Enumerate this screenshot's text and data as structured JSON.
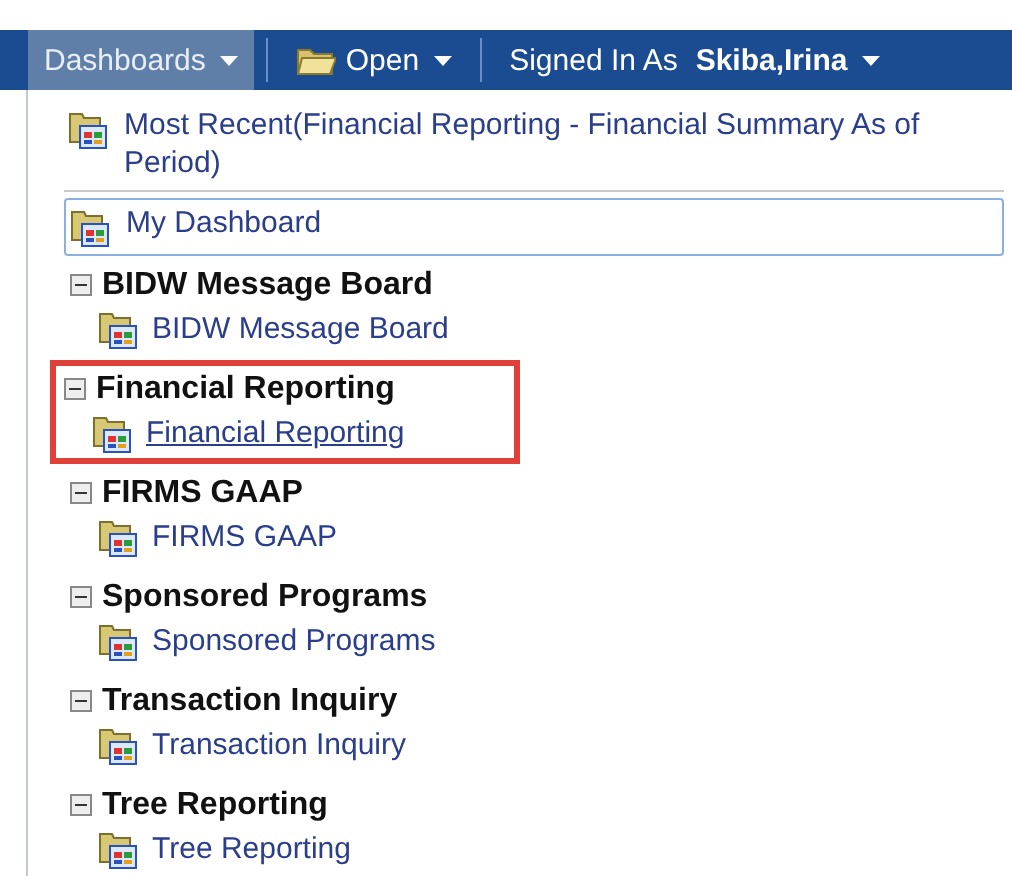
{
  "menu_bar": {
    "items": [
      {
        "label": "Dashboards",
        "kind": "dropdown",
        "selected": true
      },
      {
        "label": "Open",
        "kind": "folder",
        "selected": false
      },
      {
        "label": "Signed In As",
        "user": "Skiba,Irina",
        "kind": "user",
        "selected": false
      }
    ]
  },
  "menu": {
    "top_items": [
      {
        "label": "Most Recent(Financial Reporting - Financial Summary As of Period)",
        "focused": false
      },
      {
        "label": "My Dashboard",
        "focused": true
      }
    ],
    "groups": [
      {
        "title": "BIDW Message Board",
        "expanded": true,
        "highlighted": false,
        "children": [
          {
            "label": "BIDW Message Board",
            "hovered": false
          }
        ]
      },
      {
        "title": "Financial Reporting",
        "expanded": true,
        "highlighted": true,
        "children": [
          {
            "label": "Financial Reporting",
            "hovered": true
          }
        ]
      },
      {
        "title": "FIRMS GAAP",
        "expanded": true,
        "highlighted": false,
        "children": [
          {
            "label": "FIRMS GAAP",
            "hovered": false
          }
        ]
      },
      {
        "title": "Sponsored Programs",
        "expanded": true,
        "highlighted": false,
        "children": [
          {
            "label": "Sponsored Programs",
            "hovered": false
          }
        ]
      },
      {
        "title": "Transaction Inquiry",
        "expanded": true,
        "highlighted": false,
        "children": [
          {
            "label": "Transaction Inquiry",
            "hovered": false
          }
        ]
      },
      {
        "title": "Tree Reporting",
        "expanded": true,
        "highlighted": false,
        "children": [
          {
            "label": "Tree Reporting",
            "hovered": false
          }
        ]
      }
    ]
  }
}
